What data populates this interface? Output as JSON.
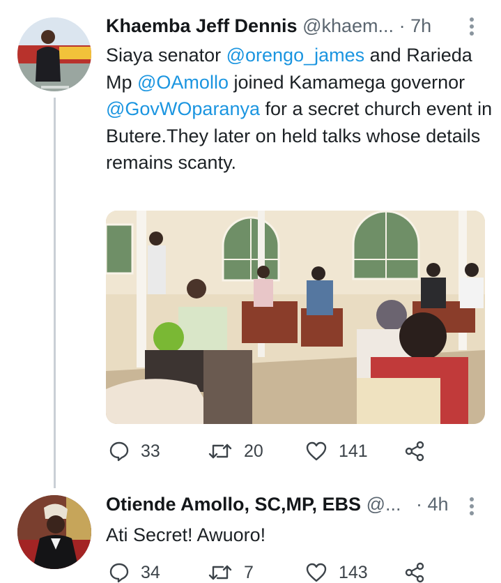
{
  "tweet1": {
    "author_name": "Khaemba Jeff Dennis",
    "author_handle": "@khaem...",
    "dot": "·",
    "time": "7h",
    "text_parts": [
      "Siaya senator ",
      "@orengo_james",
      " and Rarieda Mp ",
      "@OAmollo",
      " joined Kamamega governor ",
      "@GovWOparanya",
      " for a secret church event in Butere.They later on held talks whose details remains scanty."
    ],
    "replies": "33",
    "retweets": "20",
    "likes": "141"
  },
  "tweet2": {
    "author_name": "Otiende Amollo, SC,MP, EBS",
    "author_handle": "@...",
    "dot": "·",
    "time": "4h",
    "text": "Ati Secret! Awuoro!",
    "replies": "34",
    "retweets": "7",
    "likes": "143"
  },
  "colors": {
    "mention": "#1b95e0",
    "thread_line": "#c9cfd5"
  },
  "icons": [
    "reply-icon",
    "retweet-icon",
    "like-icon",
    "share-icon",
    "more-menu-icon"
  ]
}
